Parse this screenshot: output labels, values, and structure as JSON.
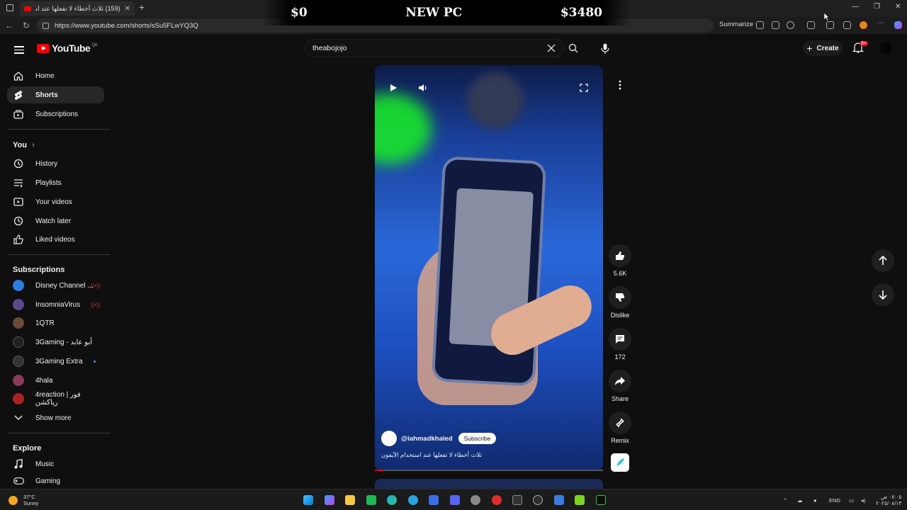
{
  "browser": {
    "tab_title": "(159) ثلاث أخطاء لا تفعلها عند است...",
    "url": "https://www.youtube.com/shorts/sSu5FLwYQ3Q",
    "summarize_label": "Summarize"
  },
  "banner": {
    "left": "$0",
    "center": "NEW PC",
    "right": "$3480"
  },
  "youtube": {
    "logo_text": "YouTube",
    "country_code": "QA",
    "search_value": "theabojojo",
    "create_label": "Create",
    "notifications_badge": "9+"
  },
  "sidebar": {
    "main": [
      {
        "label": "Home",
        "icon": "home-icon"
      },
      {
        "label": "Shorts",
        "icon": "shorts-icon",
        "active": true
      },
      {
        "label": "Subscriptions",
        "icon": "subscriptions-icon"
      }
    ],
    "you_header": "You",
    "you": [
      {
        "label": "History",
        "icon": "history-icon"
      },
      {
        "label": "Playlists",
        "icon": "playlists-icon"
      },
      {
        "label": "Your videos",
        "icon": "your-videos-icon"
      },
      {
        "label": "Watch later",
        "icon": "watch-later-icon"
      },
      {
        "label": "Liked videos",
        "icon": "liked-videos-icon"
      }
    ],
    "subs_header": "Subscriptions",
    "subscriptions": [
      {
        "label": "Disney Channel ...",
        "color": "#2c7de0",
        "live": true
      },
      {
        "label": "InsomniaVirus",
        "color": "#5b4a8a",
        "live": true
      },
      {
        "label": "1QTR",
        "color": "#6b4a3a"
      },
      {
        "label": "3Gaming - أبو عابد",
        "color": "#222222"
      },
      {
        "label": "3Gaming Extra",
        "color": "#333333",
        "new": true
      },
      {
        "label": "4hala",
        "color": "#8a3a5a"
      },
      {
        "label": "4reaction | فور رياكشن",
        "color": "#aa2222"
      }
    ],
    "show_more": "Show more",
    "explore_header": "Explore",
    "explore": [
      {
        "label": "Music",
        "icon": "music-icon"
      },
      {
        "label": "Gaming",
        "icon": "gaming-icon"
      }
    ]
  },
  "short": {
    "channel": "@iahmadkhaled",
    "subscribe_label": "Subscribe",
    "caption": "ثلاث أخطاء لا تفعلها عند استخدام الآيفون",
    "progress": 0.04
  },
  "actions": {
    "likes": "5.6K",
    "dislike_label": "Dislike",
    "comments": "172",
    "share_label": "Share",
    "remix_label": "Remix"
  },
  "taskbar": {
    "temperature": "37°C",
    "condition": "Sunny",
    "language": "ENG",
    "time": "٠٧:٠٥ ص",
    "date": "٢٠٢٥/٠٨/١٣"
  }
}
